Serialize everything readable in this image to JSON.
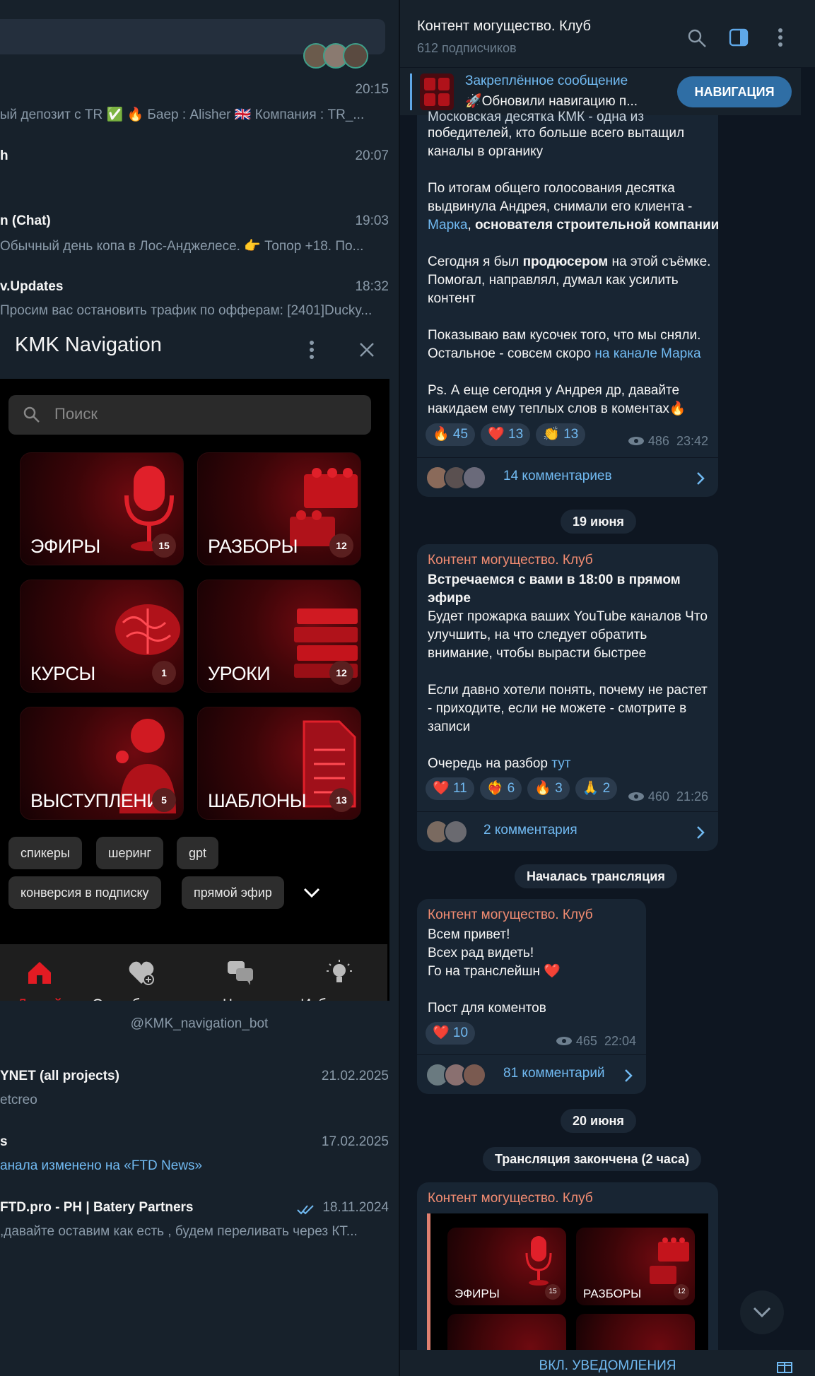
{
  "chat_list_top": [
    {
      "name": "",
      "time": "20:15",
      "preview": "ый депозит с TR ✅ 🔥 Баер : Alisher  🇬🇧 Компания : TR_..."
    },
    {
      "name": "h",
      "time": "20:07",
      "preview": ""
    },
    {
      "name": "n (Chat)",
      "time": "19:03",
      "preview": "Обычный день копа в Лос-Анджелесе.  👉 Топор +18. По..."
    },
    {
      "name": "v.Updates",
      "time": "18:32",
      "preview": "Просим вас остановить трафик по офферам: [2401]Ducky..."
    }
  ],
  "webapp": {
    "title": "KMK Navigation",
    "search_placeholder": "Поиск",
    "tiles": [
      {
        "label": "ЭФИРЫ",
        "count": "15",
        "icon": "microphone-icon"
      },
      {
        "label": "РАЗБОРЫ",
        "count": "12",
        "icon": "lego-bricks-icon"
      },
      {
        "label": "КУРСЫ",
        "count": "1",
        "icon": "brain-icon"
      },
      {
        "label": "УРОКИ",
        "count": "12",
        "icon": "books-stack-icon"
      },
      {
        "label": "ВЫСТУПЛЕНИ...",
        "count": "5",
        "icon": "speaker-person-icon"
      },
      {
        "label": "ШАБЛОНЫ",
        "count": "13",
        "icon": "document-icon"
      }
    ],
    "chips": [
      "спикеры",
      "шеринг",
      "gpt",
      "конверсия в подписку",
      "прямой эфир"
    ],
    "tabs": [
      {
        "label": "Домой",
        "icon": "home-icon",
        "active": true
      },
      {
        "label": "О сообществе",
        "icon": "heart-plus-icon",
        "active": false
      },
      {
        "label": "Чаты",
        "icon": "chat-bubbles-icon",
        "active": false
      },
      {
        "label": "Избранные",
        "icon": "lightbulb-icon",
        "active": false
      }
    ],
    "bot_name": "@KMK_navigation_bot"
  },
  "chat_list_bottom": [
    {
      "name": "YNET (all projects)",
      "time": "21.02.2025",
      "preview": "etcreo",
      "link": false
    },
    {
      "name": "s",
      "time": "17.02.2025",
      "preview": "анала изменено на «FTD News»",
      "link": true
    },
    {
      "name": "FTD.pro - PH | Batery Partners",
      "time": "18.11.2024",
      "preview": ",давайте оставим как есть  , будем переливать через КТ...",
      "link": false
    }
  ],
  "channel": {
    "title": "Контент могущество. Клуб",
    "subscribers": "612 подписчиков",
    "pinned_label": "Закреплённое сообщение",
    "pinned_text": "🚀Обновили навигацию п...",
    "pinned_button": "НАВИГАЦИЯ"
  },
  "messages": {
    "m1": {
      "cut_line": "Московская десятка КМК - одна из",
      "p1": "победителей, кто больше всего вытащил каналы в органику",
      "p2a": "По итогам общего голосования десятка выдвинула Андрея, снимали его клиента - ",
      "p2link": "Марка",
      "p2b": ", ",
      "p2bold": "основателя строительной компании",
      "p3a": "Сегодня я был ",
      "p3bold": "продюсером",
      "p3b": " на этой съёмке. Помогал, направлял, думал как усилить контент",
      "p4a": "Показываю вам кусочек того, что мы сняли. Остальное - совсем скоро ",
      "p4link": "на канале Марка",
      "p5": "Ps. А еще сегодня у Андрея др, давайте накидаем ему теплых слов в коментах🔥",
      "reactions": [
        "🔥 45",
        "❤️ 13",
        "👏 13"
      ],
      "views": "486",
      "time": "23:42",
      "comments": "14 комментариев"
    },
    "date1": "19 июня",
    "m2": {
      "sender": "Контент могущество. Клуб",
      "title": "Встречаемся с вами в 18:00 в прямом эфире",
      "p1": "Будет прожарка ваших YouTube каналов Что улучшить, на что следует обратить внимание, чтобы вырасти быстрее",
      "p2": "Если давно хотели понять, почему не растет - приходите, если не можете - смотрите в записи",
      "p3a": "Очередь на разбор ",
      "p3link": "тут",
      "reactions": [
        "❤️ 11",
        "❤️‍🔥 6",
        "🔥 3",
        "🙏 2"
      ],
      "views": "460",
      "time": "21:26",
      "comments": "2 комментария"
    },
    "service1": "Началась трансляция",
    "m3": {
      "sender": "Контент могущество. Клуб",
      "l1": "Всем привет!",
      "l2": "Всех рад видеть!",
      "l3": "Го на транслейшн ❤️",
      "l4": "Пост для коментов",
      "reactions": [
        "❤️ 10"
      ],
      "views": "465",
      "time": "22:04",
      "comments": "81 комментарий"
    },
    "date2": "20 июня",
    "service2": "Трансляция закончена (2 часа)",
    "m4": {
      "sender": "Контент могущество. Клуб",
      "tiles": [
        {
          "label": "ЭФИРЫ",
          "count": "15"
        },
        {
          "label": "РАЗБОРЫ",
          "count": "12"
        }
      ]
    }
  },
  "footer": {
    "button": "ВКЛ. УВЕДОМЛЕНИЯ"
  }
}
